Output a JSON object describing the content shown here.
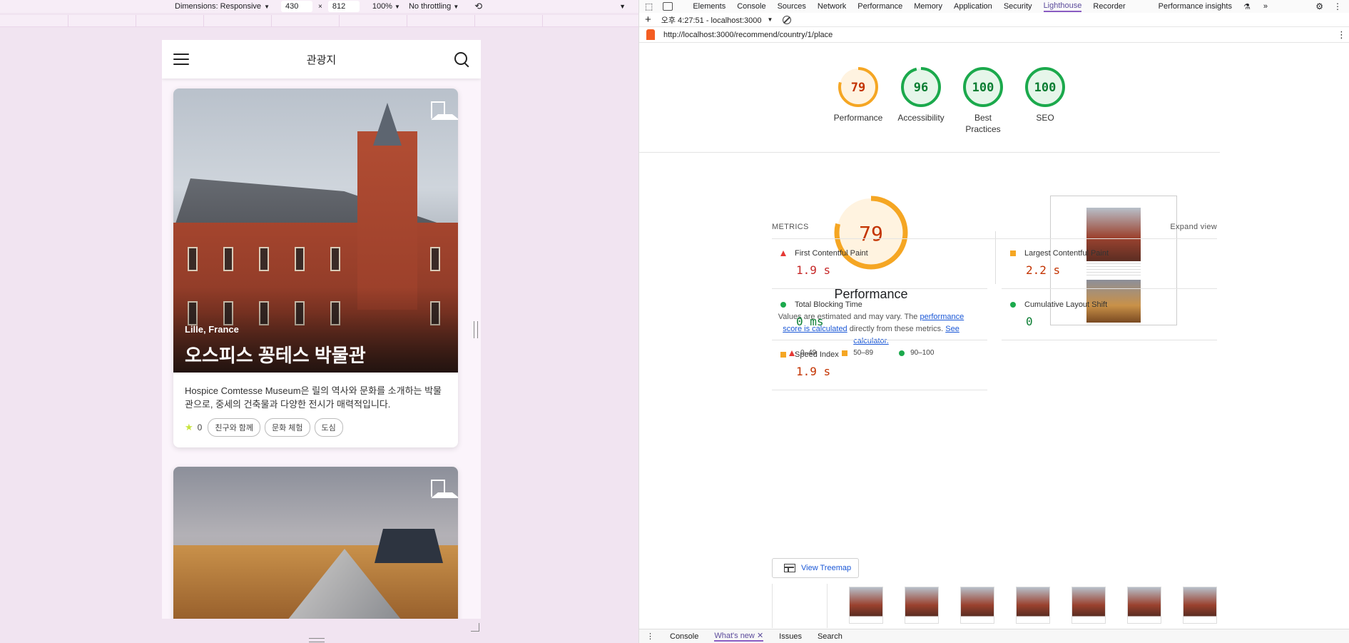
{
  "device_toolbar": {
    "dimensions_label": "Dimensions: Responsive",
    "width": "430",
    "height": "812",
    "times": "×",
    "zoom": "100%",
    "throttling": "No throttling"
  },
  "mobile": {
    "header_title": "관광지",
    "cards": [
      {
        "location": "Lille, France",
        "name": "오스피스 꽁테스 박물관",
        "description": "Hospice Comtesse Museum은 릴의 역사와 문화를 소개하는 박물관으로, 중세의 건축물과 다양한 전시가 매력적입니다.",
        "rating": "0",
        "tags": [
          "친구와 함께",
          "문화 체험",
          "도심"
        ]
      },
      {
        "location": "",
        "name": ""
      }
    ]
  },
  "devtools": {
    "tabs": [
      "Elements",
      "Console",
      "Sources",
      "Network",
      "Performance",
      "Memory",
      "Application",
      "Security",
      "Lighthouse",
      "Recorder",
      "Performance insights"
    ],
    "active_tab": "Lighthouse",
    "report_label": "오후 4:27:51 - localhost:3000",
    "url": "http://localhost:3000/recommend/country/1/place",
    "scores": [
      {
        "label": "Performance",
        "score": "79",
        "value": 79,
        "color": "#f5a623",
        "text_color": "#c33300",
        "bg": "#fff3e0"
      },
      {
        "label": "Accessibility",
        "score": "96",
        "value": 96,
        "color": "#1ba94c",
        "text_color": "#0a7d32",
        "bg": "#e6f6ea"
      },
      {
        "label": "Best Practices",
        "score": "100",
        "value": 100,
        "color": "#1ba94c",
        "text_color": "#0a7d32",
        "bg": "#e6f6ea"
      },
      {
        "label": "SEO",
        "score": "100",
        "value": 100,
        "color": "#1ba94c",
        "text_color": "#0a7d32",
        "bg": "#e6f6ea"
      }
    ],
    "perf": {
      "score": "79",
      "value": 79,
      "title": "Performance",
      "note_before": "Values are estimated and may vary. The ",
      "note_link1": "performance score is calculated",
      "note_middle": " directly from these metrics. ",
      "note_link2": "See calculator.",
      "legend": [
        "0–49",
        "50–89",
        "90–100"
      ]
    },
    "metrics": {
      "heading": "METRICS",
      "expand": "Expand view",
      "items": [
        {
          "name": "First Contentful Paint",
          "value": "1.9 s",
          "status": "fail"
        },
        {
          "name": "Largest Contentful Paint",
          "value": "2.2 s",
          "status": "average"
        },
        {
          "name": "Total Blocking Time",
          "value": "0 ms",
          "status": "pass"
        },
        {
          "name": "Cumulative Layout Shift",
          "value": "0",
          "status": "pass"
        },
        {
          "name": "Speed Index",
          "value": "1.9 s",
          "status": "average"
        }
      ]
    },
    "treemap_label": "View Treemap",
    "drawer_tabs": [
      "Console",
      "What's new",
      "Issues",
      "Search"
    ],
    "drawer_active": "What's new"
  }
}
